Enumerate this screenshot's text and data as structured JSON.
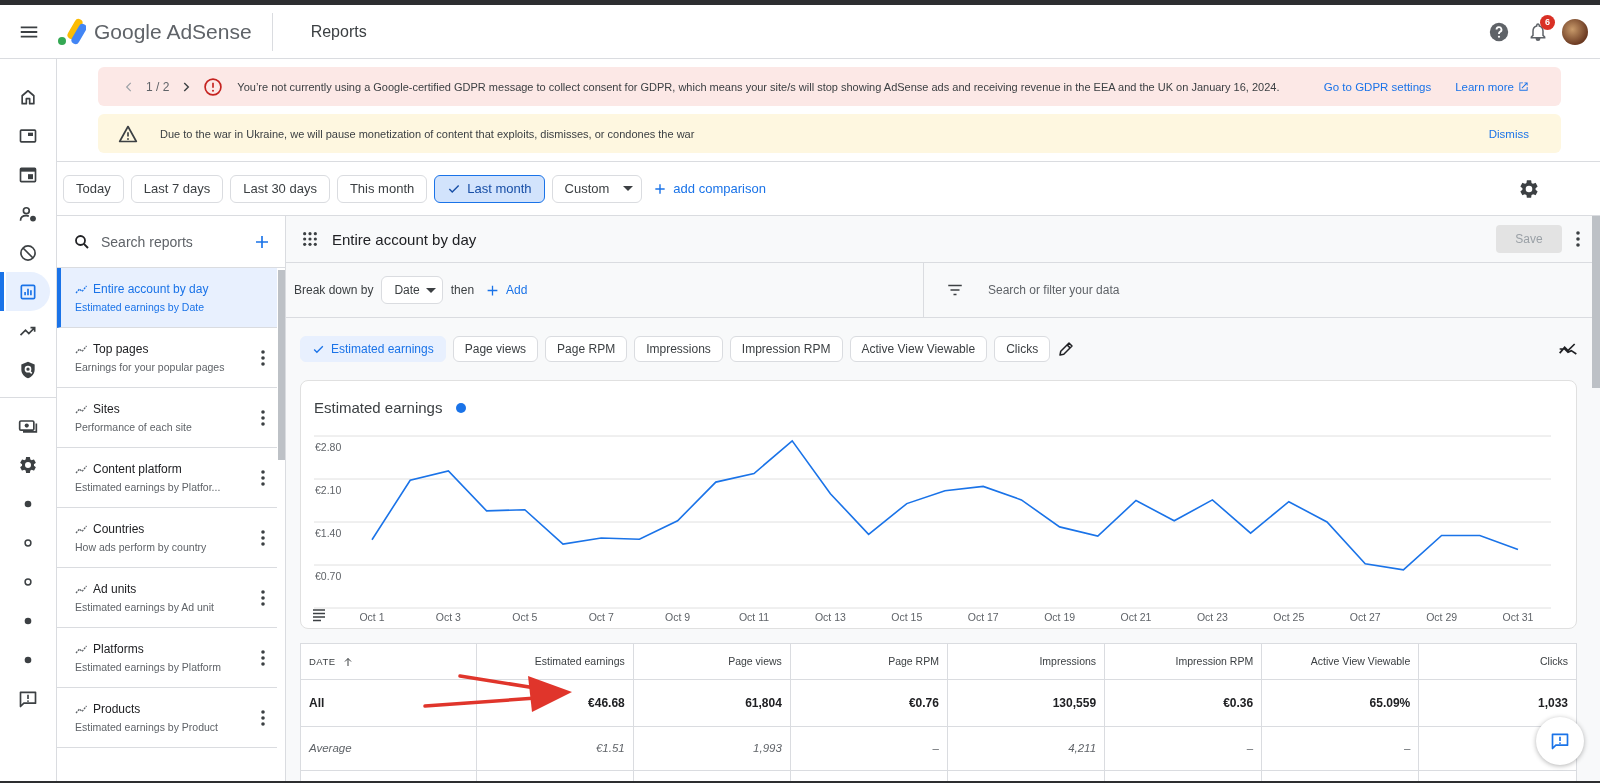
{
  "header": {
    "product": "Google AdSense",
    "page_title": "Reports",
    "notification_count": "6"
  },
  "nav_rail": [
    {
      "kind": "home",
      "selected": false
    },
    {
      "kind": "ads",
      "selected": false
    },
    {
      "kind": "layout",
      "selected": false
    },
    {
      "kind": "people",
      "selected": false
    },
    {
      "kind": "block",
      "selected": false
    },
    {
      "kind": "reports",
      "selected": true
    },
    {
      "kind": "trending",
      "selected": false
    },
    {
      "kind": "shield",
      "selected": false
    },
    {
      "kind": "payments",
      "selected": false
    },
    {
      "kind": "settings",
      "selected": false
    },
    {
      "kind": "dot",
      "selected": false
    },
    {
      "kind": "ring",
      "selected": false
    },
    {
      "kind": "ring",
      "selected": false
    },
    {
      "kind": "dot",
      "selected": false
    },
    {
      "kind": "dot",
      "selected": false
    },
    {
      "kind": "feedback",
      "selected": false
    }
  ],
  "banners": [
    {
      "kind": "error",
      "pager": "1 / 2",
      "message": "You’re not currently using a Google-certified GDPR message to collect consent for GDPR, which means your site/s will stop showing AdSense ads and receiving revenue in the EEA and the UK on January 16, 2024.",
      "links": [
        {
          "label": "Go to GDPR settings",
          "external": false
        },
        {
          "label": "Learn more",
          "external": true
        }
      ]
    },
    {
      "kind": "warning",
      "message": "Due to the war in Ukraine, we will pause monetization of content that exploits, dismisses, or condones the war",
      "links": [
        {
          "label": "Dismiss",
          "external": false
        }
      ]
    }
  ],
  "date_ranges": [
    {
      "label": "Today",
      "selected": false
    },
    {
      "label": "Last 7 days",
      "selected": false
    },
    {
      "label": "Last 30 days",
      "selected": false
    },
    {
      "label": "This month",
      "selected": false
    },
    {
      "label": "Last month",
      "selected": true
    }
  ],
  "custom_range": "Custom",
  "add_comparison": "add comparison",
  "reports_panel": {
    "search_placeholder": "Search reports",
    "items": [
      {
        "title": "Entire account by day",
        "subtitle": "Estimated earnings by Date",
        "selected": true
      },
      {
        "title": "Top pages",
        "subtitle": "Earnings for your popular pages",
        "selected": false
      },
      {
        "title": "Sites",
        "subtitle": "Performance of each site",
        "selected": false
      },
      {
        "title": "Content platform",
        "subtitle": "Estimated earnings by Platfor...",
        "selected": false
      },
      {
        "title": "Countries",
        "subtitle": "How ads perform by country",
        "selected": false
      },
      {
        "title": "Ad units",
        "subtitle": "Estimated earnings by Ad unit",
        "selected": false
      },
      {
        "title": "Platforms",
        "subtitle": "Estimated earnings by Platform",
        "selected": false
      },
      {
        "title": "Products",
        "subtitle": "Estimated earnings by Product",
        "selected": false
      }
    ]
  },
  "report": {
    "title": "Entire account by day",
    "save": {
      "label": "Save",
      "disabled": true
    },
    "breakdown": {
      "label": "Break down by",
      "value": "Date",
      "then": "then",
      "add": "Add"
    },
    "filter_placeholder": "Search or filter your data",
    "metrics": [
      {
        "label": "Estimated earnings",
        "selected": true
      },
      {
        "label": "Page views",
        "selected": false
      },
      {
        "label": "Page RPM",
        "selected": false
      },
      {
        "label": "Impressions",
        "selected": false
      },
      {
        "label": "Impression RPM",
        "selected": false
      },
      {
        "label": "Active View Viewable",
        "selected": false
      },
      {
        "label": "Clicks",
        "selected": false
      }
    ],
    "chart": {
      "chart_data": {
        "type": "line",
        "title": "Estimated earnings",
        "categories": [
          "Oct 1",
          null,
          "Oct 3",
          null,
          "Oct 5",
          null,
          "Oct 7",
          null,
          "Oct 9",
          null,
          "Oct 11",
          null,
          "Oct 13",
          null,
          "Oct 15",
          null,
          "Oct 17",
          null,
          "Oct 19",
          null,
          "Oct 21",
          null,
          "Oct 23",
          null,
          "Oct 25",
          null,
          "Oct 27",
          null,
          "Oct 29",
          null,
          "Oct 31"
        ],
        "series": [
          {
            "color": "#1a73e8",
            "values": [
              1.11,
              2.08,
              2.23,
              1.58,
              1.6,
              1.04,
              1.14,
              1.12,
              1.42,
              2.05,
              2.19,
              2.72,
              1.86,
              1.2,
              1.7,
              1.91,
              1.98,
              1.76,
              1.32,
              1.17,
              1.75,
              1.42,
              1.76,
              1.22,
              1.73,
              1.4,
              0.72,
              0.62,
              1.18,
              1.18,
              0.95
            ]
          }
        ],
        "grid": true,
        "ylim": [
          0,
          2.8
        ],
        "yticks": [
          {
            "value": 0.7,
            "label": "€0.70"
          },
          {
            "value": 1.4,
            "label": "€1.40"
          },
          {
            "value": 2.1,
            "label": "€2.10"
          },
          {
            "value": 2.8,
            "label": "€2.80"
          }
        ]
      }
    },
    "table": {
      "columns": [
        {
          "label": "DATE",
          "sorted": true
        },
        {
          "label": "Estimated earnings"
        },
        {
          "label": "Page views"
        },
        {
          "label": "Page RPM"
        },
        {
          "label": "Impressions"
        },
        {
          "label": "Impression RPM"
        },
        {
          "label": "Active View Viewable"
        },
        {
          "label": "Clicks"
        }
      ],
      "rows": [
        {
          "kind": "total",
          "cells": [
            "All",
            "€46.68",
            "61,804",
            "€0.76",
            "130,559",
            "€0.36",
            "65.09%",
            "1,033"
          ]
        },
        {
          "kind": "average",
          "cells": [
            "Average",
            "€1.51",
            "1,993",
            "–",
            "4,211",
            "–",
            "–"
          ]
        }
      ]
    }
  },
  "annotation": {
    "kind": "arrow"
  }
}
